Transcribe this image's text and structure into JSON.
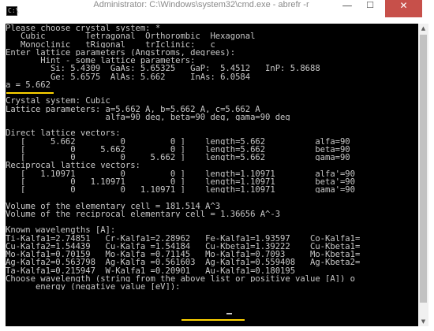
{
  "window": {
    "title": "Administrator: C:\\Windows\\system32\\cmd.exe - abrefr  -r",
    "icon_text": "C:\\",
    "buttons": {
      "minimize": "—",
      "maximize": "☐",
      "close": "✕"
    }
  },
  "colors": {
    "console_bg": "#000000",
    "console_text": "#c8c8c8",
    "highlight": "#ffd400",
    "close_button": "#c7504a"
  },
  "console": {
    "lines": [
      "Please choose crystal system: *",
      "   Cubic        Tetragonal  Orthorombic  Hexagonal",
      "   Monoclinic   tRigonal    trIclinic:   c",
      "Enter lattice parameters (Angstroms, degrees):",
      "       Hint - some lattice parameters:",
      "         Si: 5.4309  GaAs: 5.65325   GaP:  5.4512   InP: 5.8688",
      "         Ge: 5.6575  AlAs: 5.662     InAs: 6.0584",
      "a = 5.662",
      "",
      "Crystal system: Cubic",
      "Lattice parameters: a=5.662 A, b=5.662 A, c=5.662 A",
      "                    alfa=90 deg, beta=90 deg, gama=90 deg",
      "",
      "Direct lattice vectors:",
      "   [     5.662         0         0 ]    length=5.662          alfa=90",
      "   [         0     5.662         0 ]    length=5.662          beta=90",
      "   [         0         0     5.662 ]    length=5.662          gama=90",
      "Reciprocal lattice vectors:",
      "   [   1.10971         0         0 ]    length=1.10971        alfa'=90",
      "   [         0   1.10971         0 ]    length=1.10971        beta'=90",
      "   [         0         0   1.10971 ]    length=1.10971        gama'=90",
      "",
      "Volume of the elementary cell = 181.514 A^3",
      "Volume of the reciprocal elementary cell = 1.36656 A^-3",
      "",
      "Known wavelengths [A]:",
      "Ti-Kalfa1=2.74851   Cr-Kalfa1=2.28962   Fe-Kalfa1=1.93597    Co-Kalfa1=",
      "Cu-Kalfa2=1.54439   Cu-Kalfa =1.54184   Cu-Kbeta1=1.39222    Cu-Kbeta1=",
      "Mo-Kalfa1=0.70159   Mo-Kalfa =0.71145   Mo-Kalfa1=0.7093     Mo-Kbeta1=",
      "Ag-Kalfa2=0.563798  Ag-Kalfa =0.561603  Ag-Kalfa1=0.559408   Ag-Kbeta2=",
      "Ta-Kalfa1=0.215947  W-Kalfa1 =0.20901   Au-Kalfa1=0.180195",
      "Choose wavelength (string from the above list or positive value [A]) o",
      "      energy (negative value [eV]):"
    ]
  }
}
